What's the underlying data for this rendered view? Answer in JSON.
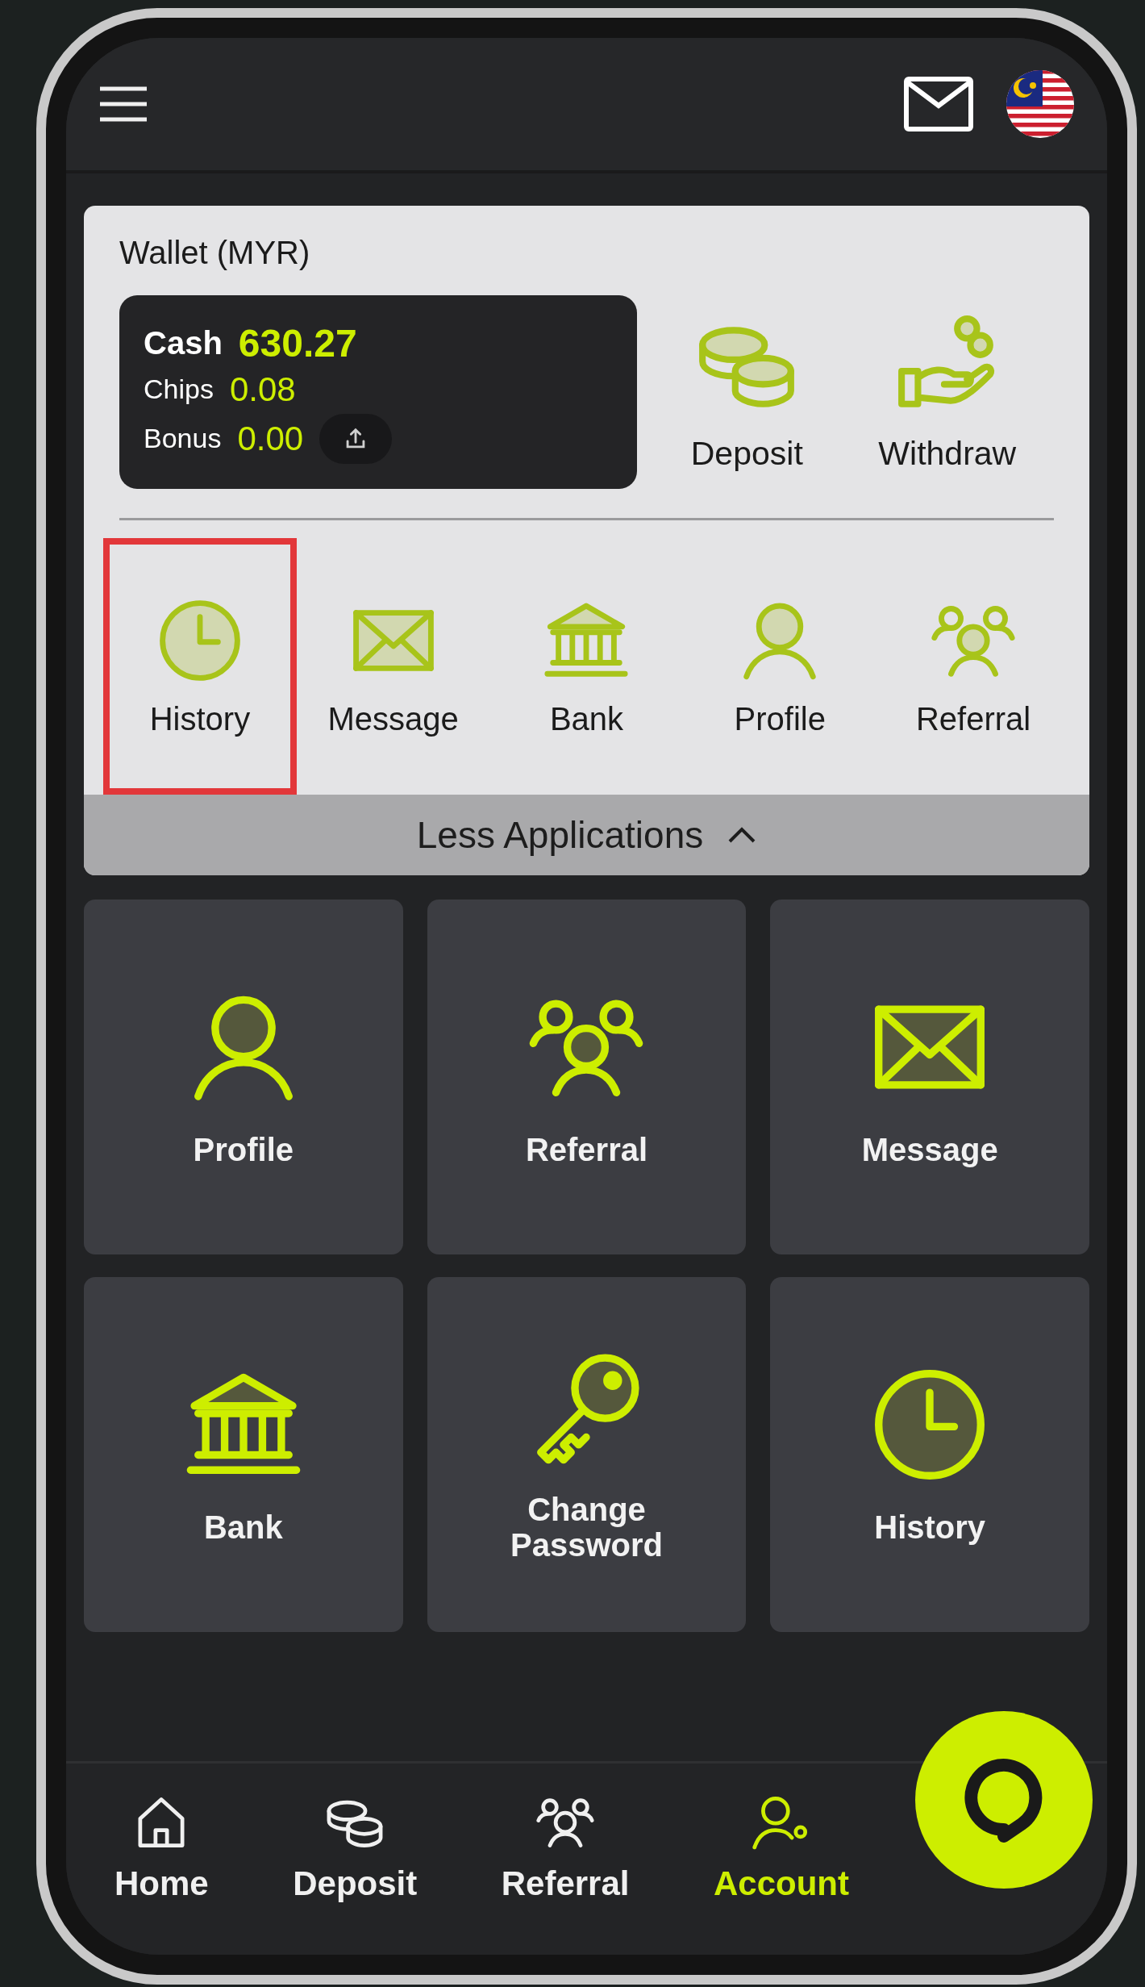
{
  "wallet": {
    "title": "Wallet (MYR)",
    "balances": [
      {
        "kind": "cash",
        "label": "Cash",
        "value": "630.27"
      },
      {
        "kind": "chips",
        "label": "Chips",
        "value": "0.08"
      },
      {
        "kind": "bonus",
        "label": "Bonus",
        "value": "0.00"
      }
    ],
    "actions": [
      {
        "kind": "coins",
        "label": "Deposit"
      },
      {
        "kind": "hand",
        "label": "Withdraw"
      }
    ],
    "shortcuts": [
      {
        "kind": "clock",
        "label": "History",
        "selected": true
      },
      {
        "kind": "mail",
        "label": "Message",
        "selected": false
      },
      {
        "kind": "bank",
        "label": "Bank",
        "selected": false
      },
      {
        "kind": "person",
        "label": "Profile",
        "selected": false
      },
      {
        "kind": "people",
        "label": "Referral",
        "selected": false
      }
    ],
    "toggle": {
      "label": "Less Applications",
      "expanded": true
    }
  },
  "tiles": [
    {
      "kind": "person",
      "label": "Profile"
    },
    {
      "kind": "people",
      "label": "Referral"
    },
    {
      "kind": "mail",
      "label": "Message"
    },
    {
      "kind": "bank",
      "label": "Bank"
    },
    {
      "kind": "key",
      "label": "Change Password"
    },
    {
      "kind": "clock",
      "label": "History"
    }
  ],
  "bottom_nav": [
    {
      "kind": "home",
      "label": "Home",
      "selected": false
    },
    {
      "kind": "coins",
      "label": "Deposit",
      "selected": false
    },
    {
      "kind": "people",
      "label": "Referral",
      "selected": false
    },
    {
      "kind": "account",
      "label": "Account",
      "selected": true
    }
  ]
}
